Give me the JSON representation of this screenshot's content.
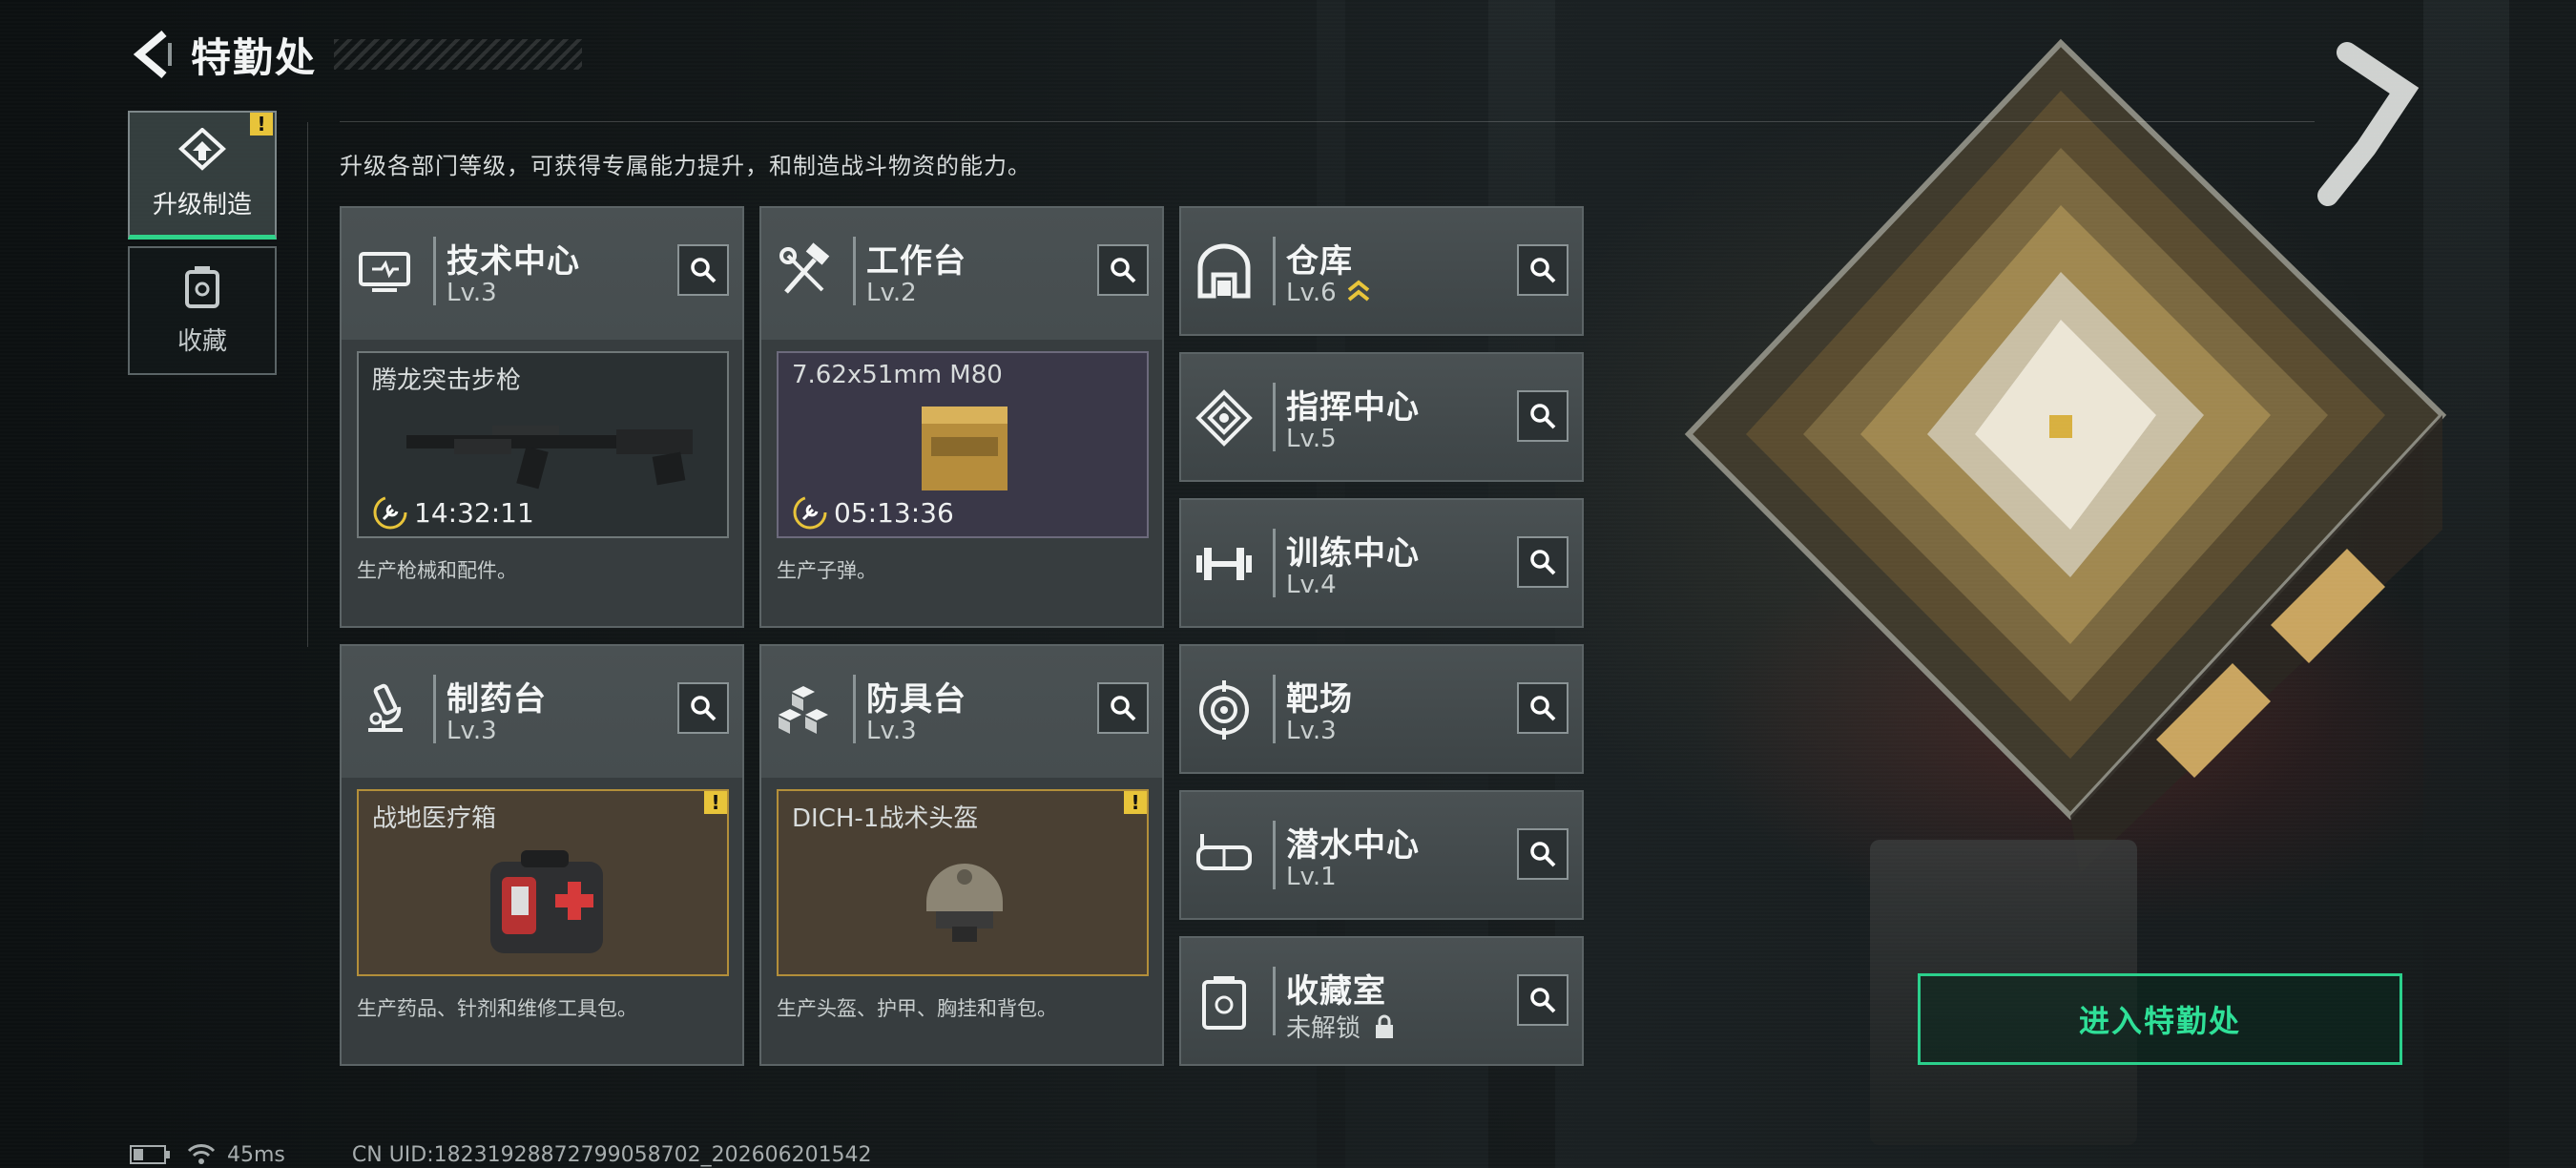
{
  "header": {
    "title": "特勤处"
  },
  "tabs": [
    {
      "label": "升级制造",
      "active": true,
      "alert": "!"
    },
    {
      "label": "收藏",
      "active": false
    }
  ],
  "subtitle": "升级各部门等级，可获得专属能力提升，和制造战斗物资的能力。",
  "departments": {
    "tech": {
      "name": "技术中心",
      "level": "Lv.3",
      "icon": "monitor-icon",
      "product": {
        "name": "腾龙突击步枪",
        "timer": "14:32:11",
        "image": "assault-rifle-image"
      },
      "desc": "生产枪械和配件。"
    },
    "workbench": {
      "name": "工作台",
      "level": "Lv.2",
      "icon": "hammer-wrench-icon",
      "product": {
        "name": "7.62x51mm M80",
        "timer": "05:13:36",
        "image": "ammo-box-image"
      },
      "desc": "生产子弹。"
    },
    "warehouse": {
      "name": "仓库",
      "level": "Lv.6",
      "icon": "warehouse-icon",
      "upgrade_icon": "upgrade-chevron-icon"
    },
    "command": {
      "name": "指挥中心",
      "level": "Lv.5",
      "icon": "command-icon"
    },
    "training": {
      "name": "训练中心",
      "level": "Lv.4",
      "icon": "dumbbell-icon"
    },
    "pharmacy": {
      "name": "制药台",
      "level": "Lv.3",
      "icon": "microscope-icon",
      "product": {
        "name": "战地医疗箱",
        "alert": "!",
        "image": "medkit-image"
      },
      "desc": "生产药品、针剂和维修工具包。"
    },
    "armor": {
      "name": "防具台",
      "level": "Lv.3",
      "icon": "armor-blocks-icon",
      "product": {
        "name": "DICH-1战术头盔",
        "alert": "!",
        "image": "helmet-image"
      },
      "desc": "生产头盔、护甲、胸挂和背包。"
    },
    "range": {
      "name": "靶场",
      "level": "Lv.3",
      "icon": "target-icon"
    },
    "diving": {
      "name": "潜水中心",
      "level": "Lv.1",
      "icon": "goggles-icon"
    },
    "collection": {
      "name": "收藏室",
      "level": "未解锁",
      "icon": "collection-icon",
      "locked": true
    }
  },
  "enter_button": {
    "label": "进入特勤处"
  },
  "footer": {
    "ping": "45ms",
    "uid": "CN UID:18231928872799058702_202606201542"
  },
  "colors": {
    "accent": "#2fd38a",
    "warning": "#e8c43a",
    "card": "#464d4f"
  }
}
